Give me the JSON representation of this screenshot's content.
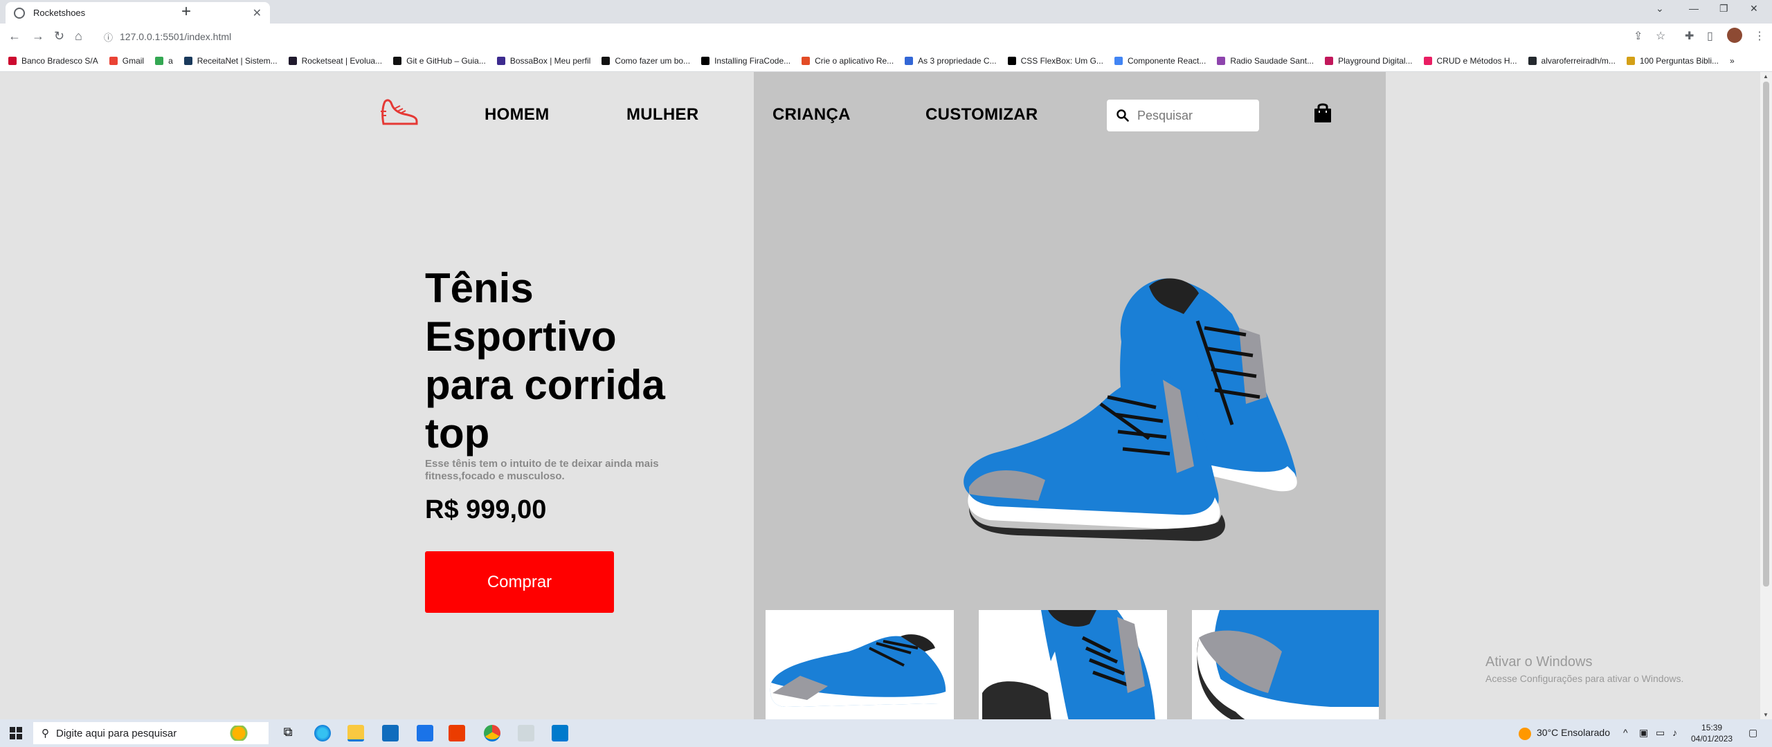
{
  "browser": {
    "tab_title": "Rocketshoes",
    "url": "127.0.0.1:5501/index.html",
    "bookmarks": [
      {
        "label": "Banco Bradesco S/A",
        "color": "#cc092f"
      },
      {
        "label": "Gmail",
        "color": "#ea4335"
      },
      {
        "label": "a",
        "color": "#34a853"
      },
      {
        "label": "ReceitaNet | Sistem...",
        "color": "#1a3a5c"
      },
      {
        "label": "Rocketseat | Evolua...",
        "color": "#201a2d"
      },
      {
        "label": "Git e GitHub – Guia...",
        "color": "#111111"
      },
      {
        "label": "BossaBox | Meu perfil",
        "color": "#3d2b8f"
      },
      {
        "label": "Como fazer um bo...",
        "color": "#111111"
      },
      {
        "label": "Installing FiraCode...",
        "color": "#000000"
      },
      {
        "label": "Crie o aplicativo Re...",
        "color": "#e34c26"
      },
      {
        "label": "As 3 propriedade C...",
        "color": "#3367d6"
      },
      {
        "label": "CSS FlexBox: Um G...",
        "color": "#000000"
      },
      {
        "label": "Componente React...",
        "color": "#4285f4"
      },
      {
        "label": "Radio Saudade Sant...",
        "color": "#8e44ad"
      },
      {
        "label": "Playground Digital...",
        "color": "#c2185b"
      },
      {
        "label": "CRUD e Métodos H...",
        "color": "#e91e63"
      },
      {
        "label": "alvaroferreiradh/m...",
        "color": "#24292e"
      },
      {
        "label": "100 Perguntas Bibli...",
        "color": "#d4a017"
      }
    ]
  },
  "site": {
    "nav": {
      "homem": "HOMEM",
      "mulher": "MULHER",
      "crianca": "CRIANÇA",
      "customizar": "CUSTOMIZAR"
    },
    "search_placeholder": "Pesquisar",
    "title_lines": [
      "Tênis",
      "Esportivo",
      "para corrida",
      "top"
    ],
    "description": "Esse tênis tem o intuito de te deixar ainda mais fitness,focado e musculoso.",
    "price": "R$ 999,00",
    "buy_label": "Comprar",
    "accent_color": "#ff0000",
    "right_panel_color": "#c4c4c4"
  },
  "watermark": {
    "title": "Ativar o Windows",
    "subtitle": "Acesse Configurações para ativar o Windows."
  },
  "taskbar": {
    "search_placeholder": "Digite aqui para pesquisar",
    "weather": "30°C  Ensolarado",
    "time": "15:39",
    "date": "04/01/2023"
  }
}
